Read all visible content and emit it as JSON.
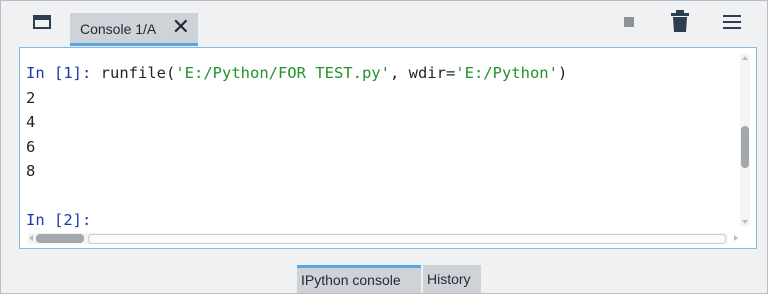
{
  "toolbar": {
    "tab_label": "Console 1/A",
    "tab_close": "✕",
    "icons": [
      "window-icon",
      "stop-icon",
      "trash-icon",
      "menu-icon"
    ]
  },
  "console": {
    "line1_prompt": "In [1]:",
    "line1_func": "runfile(",
    "line1_arg1": "'E:/Python/FOR TEST.py'",
    "line1_sep": ", wdir=",
    "line1_arg2": "'E:/Python'",
    "line1_end": ")",
    "outputs": [
      "2",
      "4",
      "6",
      "8"
    ],
    "line2_prompt": "In [2]:"
  },
  "bottom_tabs": {
    "ipython": "IPython console",
    "history": "History"
  },
  "colors": {
    "prompt": "#1b3aa8",
    "string": "#22922b",
    "accent": "#57a7e0"
  }
}
